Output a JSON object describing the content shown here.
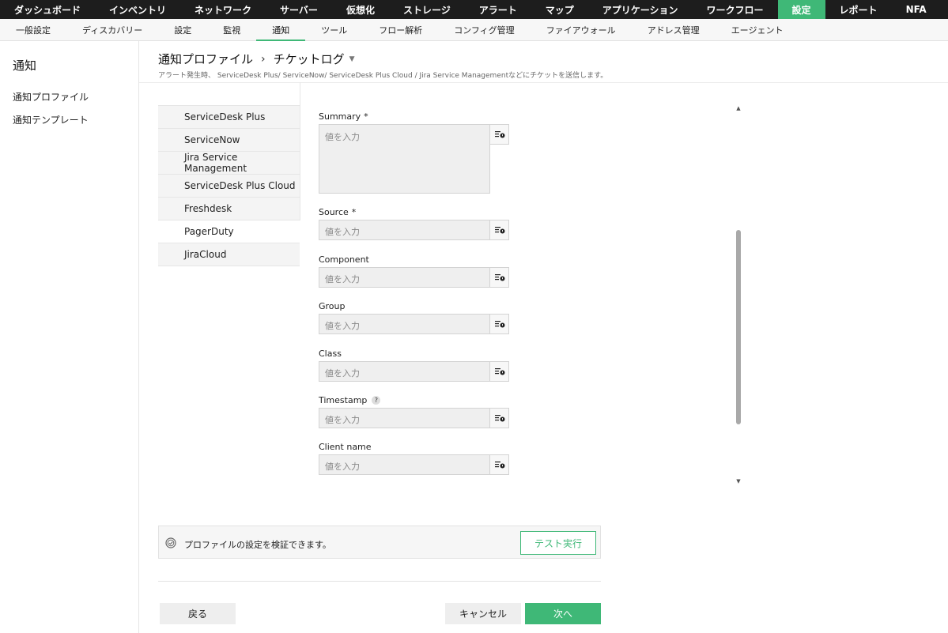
{
  "topnav": {
    "items": [
      "ダッシュボード",
      "インベントリ",
      "ネットワーク",
      "サーバー",
      "仮想化",
      "ストレージ",
      "アラート",
      "マップ",
      "アプリケーション",
      "ワークフロー",
      "設定",
      "レポート",
      "NFA"
    ],
    "active": "設定"
  },
  "subnav": {
    "items": [
      "一般設定",
      "ディスカバリー",
      "設定",
      "監視",
      "通知",
      "ツール",
      "フロー解析",
      "コンフィグ管理",
      "ファイアウォール",
      "アドレス管理",
      "エージェント"
    ],
    "active": "通知"
  },
  "sidebar": {
    "title": "通知",
    "links": [
      "通知プロファイル",
      "通知テンプレート"
    ]
  },
  "header": {
    "breadcrumb_parent": "通知プロファイル",
    "breadcrumb_current": "チケットログ",
    "subtitle": "アラート発生時、 ServiceDesk Plus/ ServiceNow/ ServiceDesk Plus Cloud / Jira Service Managementなどにチケットを送信します。"
  },
  "integrations": {
    "items": [
      "ServiceDesk Plus",
      "ServiceNow",
      "Jira Service Management",
      "ServiceDesk Plus Cloud",
      "Freshdesk",
      "PagerDuty",
      "JiraCloud"
    ],
    "active": "PagerDuty"
  },
  "form": {
    "placeholder": "値を入力",
    "fields": [
      {
        "label": "Summary",
        "required": true
      },
      {
        "label": "Source",
        "required": true
      },
      {
        "label": "Component",
        "required": false
      },
      {
        "label": "Group",
        "required": false
      },
      {
        "label": "Class",
        "required": false
      },
      {
        "label": "Timestamp",
        "required": false,
        "help": "?"
      },
      {
        "label": "Client name",
        "required": false
      }
    ],
    "required_mark": "*"
  },
  "test": {
    "text": "プロファイルの設定を検証できます。",
    "button": "テスト実行"
  },
  "buttons": {
    "back": "戻る",
    "cancel": "キャンセル",
    "next": "次へ"
  },
  "colors": {
    "accent": "#3fb877",
    "topnav_bg": "#1d1d1d"
  }
}
